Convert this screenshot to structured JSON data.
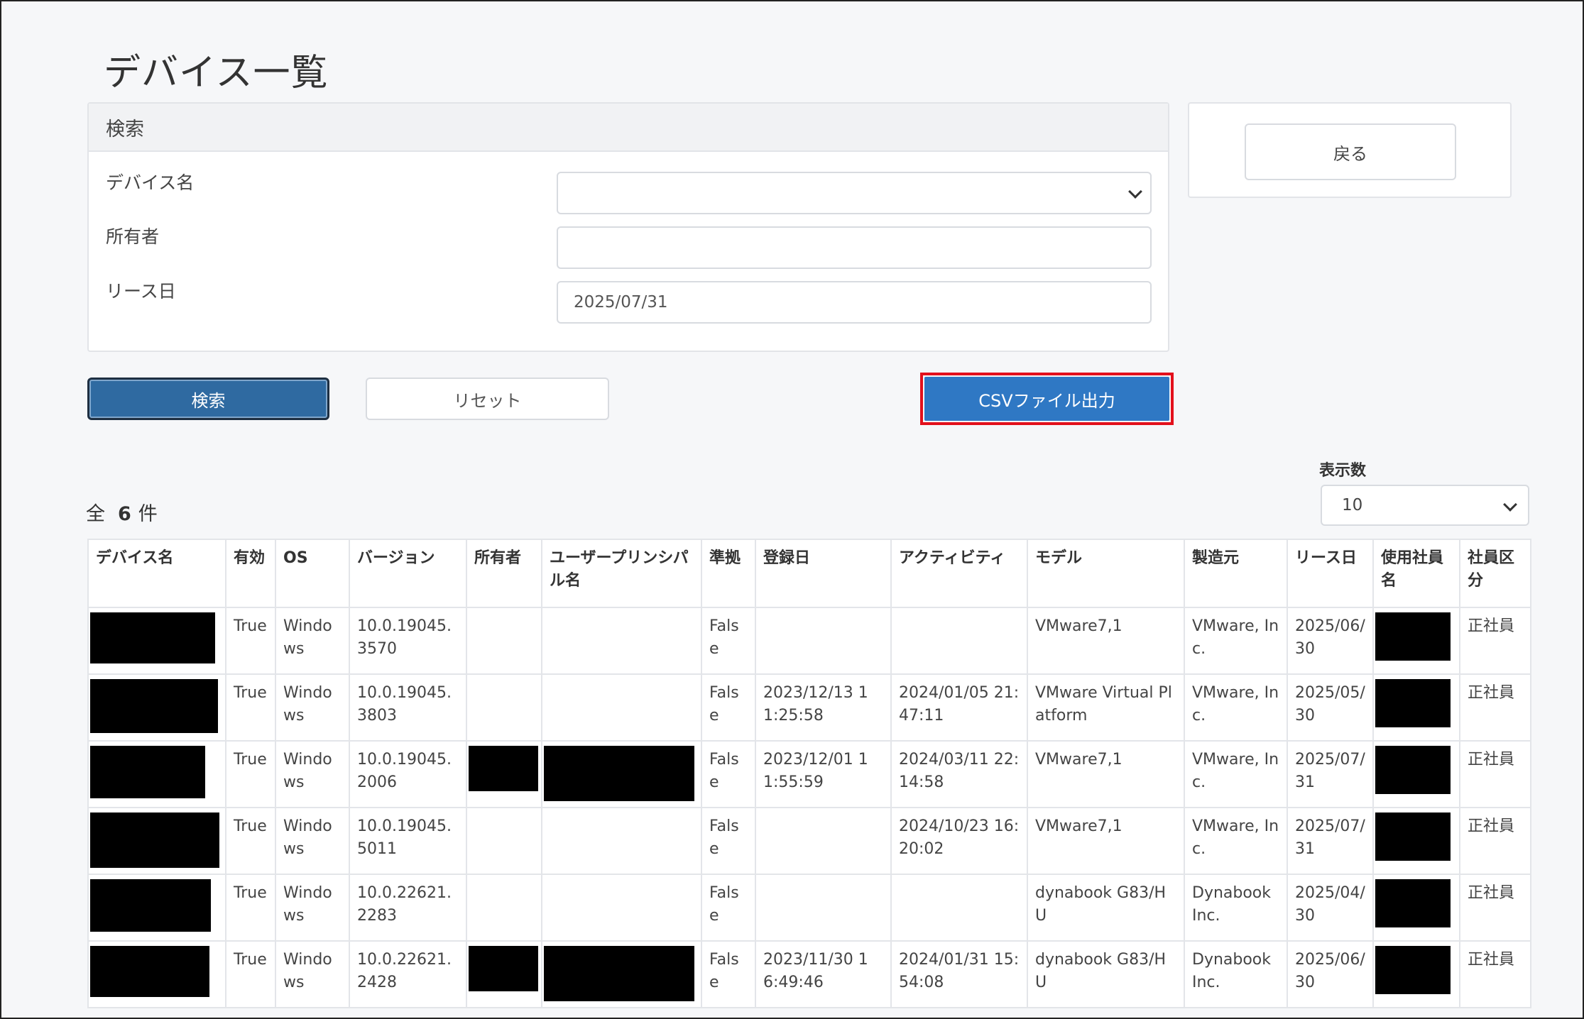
{
  "page": {
    "title": "デバイス一覧"
  },
  "search": {
    "header": "検索",
    "fields": {
      "device_name": {
        "label": "デバイス名",
        "value": ""
      },
      "owner": {
        "label": "所有者",
        "value": ""
      },
      "lease_date": {
        "label": "リース日",
        "value": "2025/07/31"
      }
    },
    "buttons": {
      "search": "検索",
      "reset": "リセット",
      "csv": "CSVファイル出力"
    }
  },
  "back_button": "戻る",
  "summary": {
    "prefix": "全",
    "count": "6",
    "suffix": "件"
  },
  "page_size": {
    "label": "表示数",
    "value": "10"
  },
  "table": {
    "headers": [
      "デバイス名",
      "有効",
      "OS",
      "バージョン",
      "所有者",
      "ユーザープリンシパル名",
      "準拠",
      "登録日",
      "アクティビティ",
      "モデル",
      "製造元",
      "リース日",
      "使用社員名",
      "社員区分"
    ],
    "rows": [
      {
        "enabled": "True",
        "os": "Windows",
        "version": "10.0.19045.3570",
        "compliant": "False",
        "registered": "",
        "activity": "",
        "model": "VMware7,1",
        "manufacturer": "VMware, Inc.",
        "lease": "2025/06/30",
        "category": "正社員",
        "owner_redacted": false,
        "upn_redacted": false
      },
      {
        "enabled": "True",
        "os": "Windows",
        "version": "10.0.19045.3803",
        "compliant": "False",
        "registered": "2023/12/13 11:25:58",
        "activity": "2024/01/05 21:47:11",
        "model": "VMware Virtual Platform",
        "manufacturer": "VMware, Inc.",
        "lease": "2025/05/30",
        "category": "正社員",
        "owner_redacted": false,
        "upn_redacted": false
      },
      {
        "enabled": "True",
        "os": "Windows",
        "version": "10.0.19045.2006",
        "compliant": "False",
        "registered": "2023/12/01 11:55:59",
        "activity": "2024/03/11 22:14:58",
        "model": "VMware7,1",
        "manufacturer": "VMware, Inc.",
        "lease": "2025/07/31",
        "category": "正社員",
        "owner_redacted": true,
        "upn_redacted": true
      },
      {
        "enabled": "True",
        "os": "Windows",
        "version": "10.0.19045.5011",
        "compliant": "False",
        "registered": "",
        "activity": "2024/10/23 16:20:02",
        "model": "VMware7,1",
        "manufacturer": "VMware, Inc.",
        "lease": "2025/07/31",
        "category": "正社員",
        "owner_redacted": false,
        "upn_redacted": false
      },
      {
        "enabled": "True",
        "os": "Windows",
        "version": "10.0.22621.2283",
        "compliant": "False",
        "registered": "",
        "activity": "",
        "model": "dynabook G83/HU",
        "manufacturer": "Dynabook Inc.",
        "lease": "2025/04/30",
        "category": "正社員",
        "owner_redacted": false,
        "upn_redacted": false
      },
      {
        "enabled": "True",
        "os": "Windows",
        "version": "10.0.22621.2428",
        "compliant": "False",
        "registered": "2023/11/30 16:49:46",
        "activity": "2024/01/31 15:54:08",
        "model": "dynabook G83/HU",
        "manufacturer": "Dynabook Inc.",
        "lease": "2025/06/30",
        "category": "正社員",
        "owner_redacted": true,
        "upn_redacted": true
      }
    ]
  },
  "colors": {
    "primary": "#2f6aa1",
    "csv_button": "#2f78c4",
    "highlight": "#e3101c",
    "redaction": "#000000"
  }
}
